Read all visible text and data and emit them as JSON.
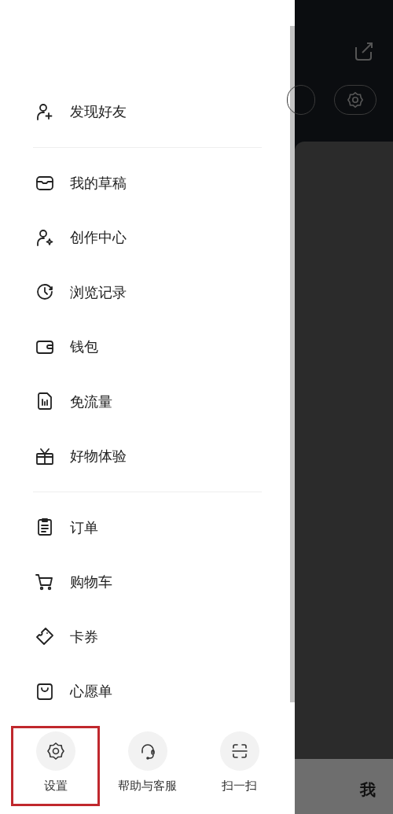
{
  "drawer": {
    "groups": [
      {
        "items": [
          {
            "label": "发现好友"
          }
        ]
      },
      {
        "items": [
          {
            "label": "我的草稿"
          },
          {
            "label": "创作中心"
          },
          {
            "label": "浏览记录"
          },
          {
            "label": "钱包"
          },
          {
            "label": "免流量"
          },
          {
            "label": "好物体验"
          }
        ]
      },
      {
        "items": [
          {
            "label": "订单"
          },
          {
            "label": "购物车"
          },
          {
            "label": "卡券"
          },
          {
            "label": "心愿单"
          }
        ]
      }
    ],
    "bottom_actions": [
      {
        "label": "设置",
        "highlighted": true
      },
      {
        "label": "帮助与客服",
        "highlighted": false
      },
      {
        "label": "扫一扫",
        "highlighted": false
      }
    ]
  },
  "tab_bar": {
    "tabs": [
      {
        "label": "我"
      }
    ]
  }
}
